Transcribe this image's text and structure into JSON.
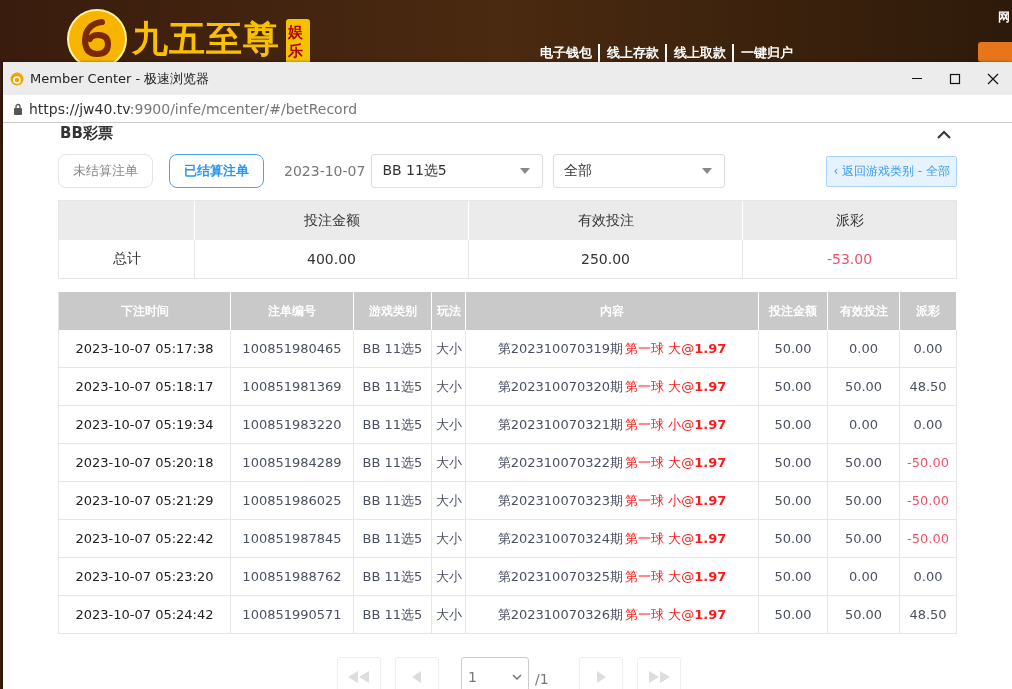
{
  "site": {
    "logo_text": "九五至尊",
    "logo_badge": "娱乐",
    "links": [
      "电子钱包",
      "线上存款",
      "线上取款",
      "一键归户"
    ],
    "corner_text": "网"
  },
  "window": {
    "title": "Member Center - 极速浏览器",
    "url_host": "https://jw40.tv",
    "url_rest": ":9900/infe/mcenter/#/betRecord"
  },
  "section_title": "BB彩票",
  "filters": {
    "tabs": [
      {
        "label": "未结算注单",
        "selected": false
      },
      {
        "label": "已结算注单",
        "selected": true
      }
    ],
    "date": "2023-10-07",
    "game_select": "BB 11选5",
    "type_select": "全部",
    "back_button": "‹ 返回游戏类别 - 全部"
  },
  "summary": {
    "columns": [
      "投注金额",
      "有效投注",
      "派彩"
    ],
    "row_label": "总计",
    "values": [
      "400.00",
      "250.00",
      "-53.00"
    ],
    "payout_negative": true
  },
  "table": {
    "columns": [
      "下注时间",
      "注单编号",
      "游戏类别",
      "玩法",
      "内容",
      "投注金额",
      "有效投注",
      "派彩"
    ],
    "rows": [
      {
        "time": "2023-10-07 05:17:38",
        "id": "100851980465",
        "game": "BB 11选5",
        "play": "大小",
        "period": "第202310070319期",
        "bet": "第一球 大@**1.97**",
        "amount": "50.00",
        "valid": "0.00",
        "payout": "0.00",
        "payout_negative": false
      },
      {
        "time": "2023-10-07 05:18:17",
        "id": "100851981369",
        "game": "BB 11选5",
        "play": "大小",
        "period": "第202310070320期",
        "bet": "第一球 大@**1.97**",
        "amount": "50.00",
        "valid": "50.00",
        "payout": "48.50",
        "payout_negative": false
      },
      {
        "time": "2023-10-07 05:19:34",
        "id": "100851983220",
        "game": "BB 11选5",
        "play": "大小",
        "period": "第202310070321期",
        "bet": "第一球 小@**1.97**",
        "amount": "50.00",
        "valid": "0.00",
        "payout": "0.00",
        "payout_negative": false
      },
      {
        "time": "2023-10-07 05:20:18",
        "id": "100851984289",
        "game": "BB 11选5",
        "play": "大小",
        "period": "第202310070322期",
        "bet": "第一球 大@**1.97**",
        "amount": "50.00",
        "valid": "50.00",
        "payout": "-50.00",
        "payout_negative": true
      },
      {
        "time": "2023-10-07 05:21:29",
        "id": "100851986025",
        "game": "BB 11选5",
        "play": "大小",
        "period": "第202310070323期",
        "bet": "第一球 小@**1.97**",
        "amount": "50.00",
        "valid": "50.00",
        "payout": "-50.00",
        "payout_negative": true
      },
      {
        "time": "2023-10-07 05:22:42",
        "id": "100851987845",
        "game": "BB 11选5",
        "play": "大小",
        "period": "第202310070324期",
        "bet": "第一球 大@**1.97**",
        "amount": "50.00",
        "valid": "50.00",
        "payout": "-50.00",
        "payout_negative": true
      },
      {
        "time": "2023-10-07 05:23:20",
        "id": "100851988762",
        "game": "BB 11选5",
        "play": "大小",
        "period": "第202310070325期",
        "bet": "第一球 大@**1.97**",
        "amount": "50.00",
        "valid": "0.00",
        "payout": "0.00",
        "payout_negative": false
      },
      {
        "time": "2023-10-07 05:24:42",
        "id": "100851990571",
        "game": "BB 11选5",
        "play": "大小",
        "period": "第202310070326期",
        "bet": "第一球 大@**1.97**",
        "amount": "50.00",
        "valid": "50.00",
        "payout": "48.50",
        "payout_negative": false
      }
    ]
  },
  "pagination": {
    "page": "1",
    "total": "/1"
  }
}
